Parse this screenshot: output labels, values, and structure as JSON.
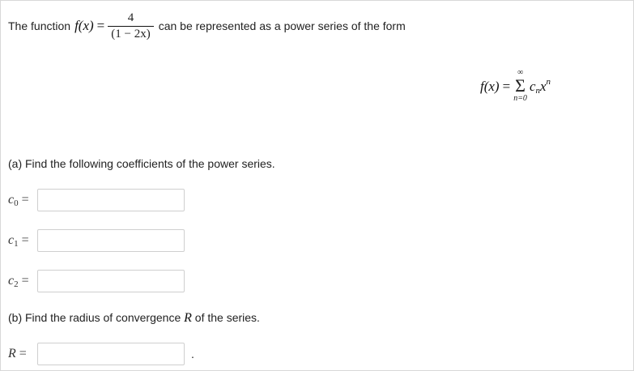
{
  "intro": {
    "prefix": "The function",
    "func": "f(x)",
    "equals": "=",
    "numerator": "4",
    "denominator": "(1 − 2x)",
    "suffix": "can be represented as a power series of the form"
  },
  "series": {
    "lhs": "f(x)",
    "equals": "=",
    "upper": "∞",
    "sigma": "Σ",
    "lower": "n=0",
    "term_c": "c",
    "term_c_sub": "n",
    "term_x": "x",
    "term_x_sup": "n"
  },
  "part_a": {
    "prompt": "(a) Find the following coefficients of the power series.",
    "fields": [
      {
        "var": "c",
        "sub": "0",
        "eq": "=",
        "value": ""
      },
      {
        "var": "c",
        "sub": "1",
        "eq": "=",
        "value": ""
      },
      {
        "var": "c",
        "sub": "2",
        "eq": "=",
        "value": ""
      }
    ]
  },
  "part_b": {
    "prompt_before": "(b) Find the radius of convergence",
    "prompt_var": "R",
    "prompt_after": "of the series.",
    "field": {
      "var": "R",
      "eq": "=",
      "value": ""
    },
    "trailing": "."
  }
}
